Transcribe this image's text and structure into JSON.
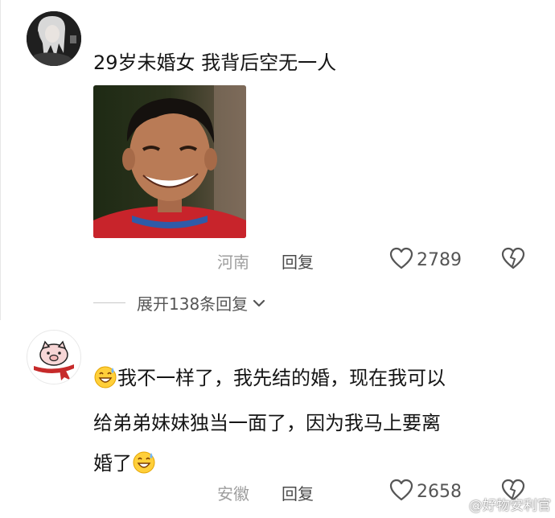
{
  "comments": [
    {
      "text": "29岁未婚女 我背后空无一人",
      "location": "河南",
      "reply_label": "回复",
      "likes": "2789",
      "expand_label": "展开138条回复"
    },
    {
      "text_line1": "我不一样了，我先结的婚，现在我可以",
      "text_line2": "给弟弟妹妹独当一面了，因为我马上要离",
      "text_line3": "婚了",
      "location": "安徽",
      "reply_label": "回复",
      "likes": "2658"
    }
  ],
  "watermark": "@好物安利官",
  "icons": {
    "heart": "heart-icon",
    "dislike": "broken-heart-icon",
    "chevron": "chevron-down-icon",
    "emoji": "grinning-sweat-emoji-icon",
    "avatar2": "pig-with-scarf-icon"
  }
}
